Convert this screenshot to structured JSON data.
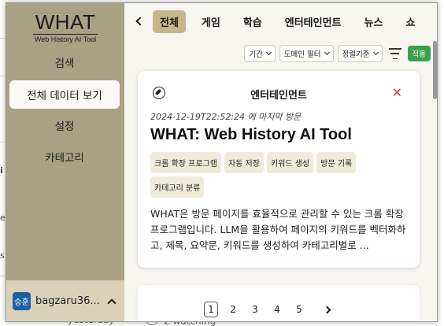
{
  "background": {
    "side_chars": [
      "i",
      "e",
      "s"
    ],
    "yesterday": "yesterday",
    "watching": "2 watching"
  },
  "sidebar": {
    "logo_title": "WHAT",
    "logo_subtitle": "Web History AI Tool",
    "items": [
      {
        "label": "검색",
        "active": false
      },
      {
        "label": "전체 데이터 보기",
        "active": true
      },
      {
        "label": "설정",
        "active": false
      },
      {
        "label": "카테고리",
        "active": false
      }
    ],
    "user": {
      "avatar_text": "승훈",
      "name": "bagzaru36...",
      "avatar_color": "#1f5fa6"
    }
  },
  "tabs": [
    {
      "label": "전체",
      "active": true
    },
    {
      "label": "게임",
      "active": false
    },
    {
      "label": "학습",
      "active": false
    },
    {
      "label": "엔터테인먼트",
      "active": false
    },
    {
      "label": "뉴스",
      "active": false
    },
    {
      "label": "쇼",
      "active": false
    }
  ],
  "filters": {
    "period": "기간",
    "domain": "도메인 필터",
    "sort": "정렬기준",
    "apply": "적용"
  },
  "card": {
    "category": "엔터테인먼트",
    "last_visit": "2024-12-19T22:52:24 에 마지막 방문",
    "title": "WHAT: Web History AI Tool",
    "keywords": [
      "크롬 확장 프로그램",
      "자동 저장",
      "키워드 생성",
      "방문 기록",
      "카테고리 분류"
    ],
    "description": "WHAT은 방문 페이지를 효율적으로 관리할 수 있는 크롬 확장 프로그램입니다. LLM을 활용하여 페이지의 키워드를 벡터화하고, 제목, 요약문, 키워드를 생성하여 카테고리별로 ..."
  },
  "pagination": {
    "pages": [
      "1",
      "2",
      "3",
      "4",
      "5"
    ],
    "current": "1"
  },
  "colors": {
    "sidebar_bg": "#a8a184",
    "active_tab": "#c4b78a",
    "apply_button": "#3aa04a",
    "close_icon": "#dd3333"
  }
}
